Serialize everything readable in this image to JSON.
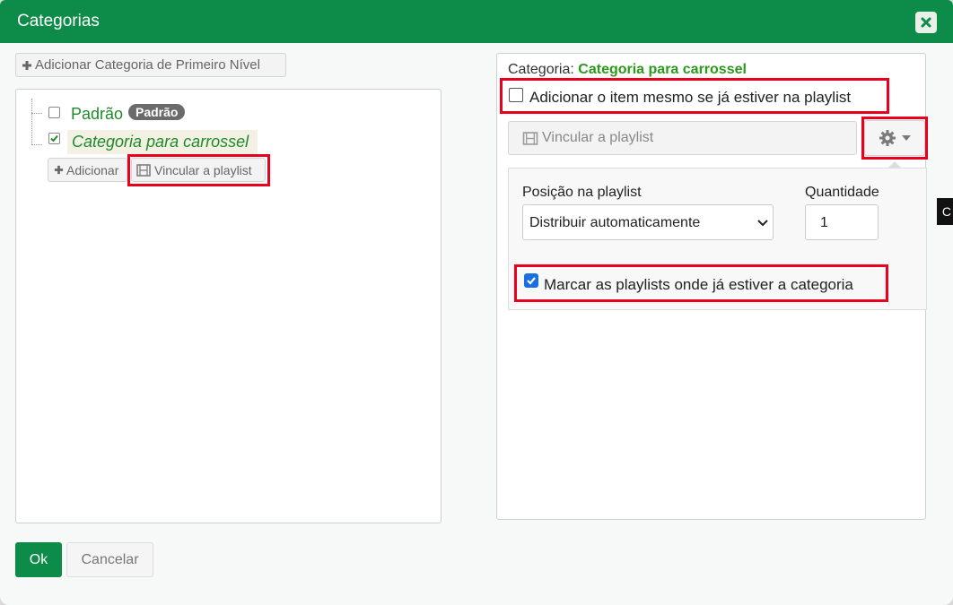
{
  "dialog": {
    "title": "Categorias",
    "close_icon": "close-icon"
  },
  "left": {
    "add_top_level_label": "Adicionar Categoria de Primeiro Nível",
    "tree": [
      {
        "label": "Padrão",
        "badge": "Padrão",
        "checked": false
      },
      {
        "label": "Categoria para carrossel",
        "checked": true
      }
    ],
    "actions": {
      "add_label": "Adicionar",
      "link_playlist_label": "Vincular a playlist"
    }
  },
  "right": {
    "category_prefix": "Categoria:",
    "category_name": "Categoria para carrossel",
    "add_even_if_present_label": "Adicionar o item mesmo se já estiver na playlist",
    "link_playlist_button": "Vincular a playlist",
    "position_label": "Posição na playlist",
    "position_value": "Distribuir automaticamente",
    "quantity_label": "Quantidade",
    "quantity_value": "1",
    "mark_playlists_label": "Marcar as playlists onde já estiver a categoria",
    "mark_playlists_checked": true
  },
  "footer": {
    "ok_label": "Ok",
    "cancel_label": "Cancelar"
  },
  "tooltip_edge_text": "C",
  "colors": {
    "header": "#0d8b48",
    "green_text": "#1f8a2a",
    "highlight": "#e8001c",
    "badge": "#6b6b6b"
  }
}
